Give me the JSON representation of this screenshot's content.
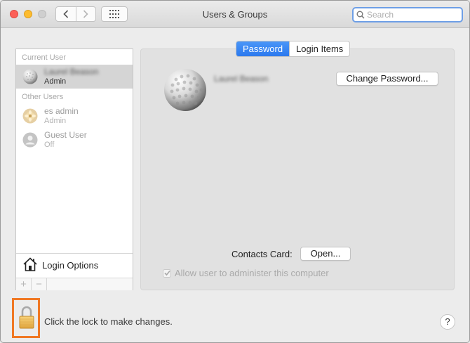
{
  "window": {
    "title": "Users & Groups"
  },
  "search": {
    "placeholder": "Search"
  },
  "sidebar": {
    "current_user_header": "Current User",
    "current_user": {
      "name": "Laurel Beason",
      "role": "Admin"
    },
    "other_users_header": "Other Users",
    "other_users": [
      {
        "name": "es admin",
        "role": "Admin",
        "avatar": "flower-avatar-icon"
      },
      {
        "name": "Guest User",
        "role": "Off",
        "avatar": "generic-person-icon"
      }
    ],
    "login_options_label": "Login Options",
    "add_label": "+",
    "remove_label": "−"
  },
  "tabs": [
    {
      "label": "Password",
      "active": true
    },
    {
      "label": "Login Items",
      "active": false
    }
  ],
  "main": {
    "full_name": "Laurel Beason",
    "change_password_label": "Change Password...",
    "contacts_card_label": "Contacts Card:",
    "open_label": "Open...",
    "allow_admin_label": "Allow user to administer this computer",
    "allow_admin_checked": true
  },
  "footer": {
    "lock_text": "Click the lock to make changes.",
    "help_label": "?"
  },
  "colors": {
    "accent": "#2b79ee",
    "lock_highlight": "#f07824",
    "search_focus": "#6e9fe6"
  }
}
